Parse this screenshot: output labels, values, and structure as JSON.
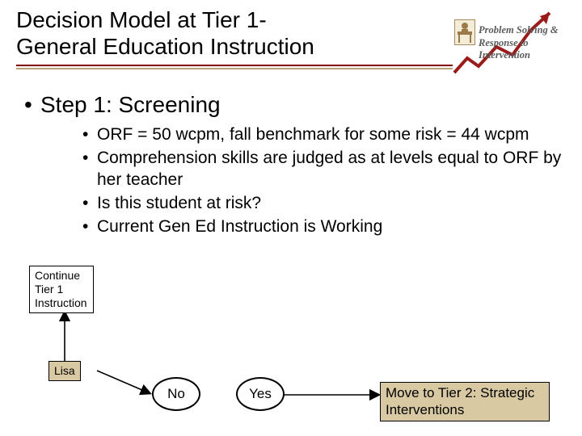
{
  "title_line1": "Decision Model at Tier 1-",
  "title_line2": "General Education Instruction",
  "logo": {
    "line1": "Problem Solving &",
    "line2": "Response to Intervention"
  },
  "step_heading": "Step 1:  Screening",
  "bullets": [
    "ORF = 50 wcpm, fall benchmark for some risk = 44 wcpm",
    "Comprehension skills are judged as at levels equal to ORF by her teacher",
    "Is this student at risk?",
    "Current Gen Ed Instruction is Working"
  ],
  "diagram": {
    "continue_box": "Continue Tier 1 Instruction",
    "lisa_box": "Lisa",
    "no_oval": "No",
    "yes_oval": "Yes",
    "move_box": "Move to Tier 2: Strategic Interventions"
  }
}
